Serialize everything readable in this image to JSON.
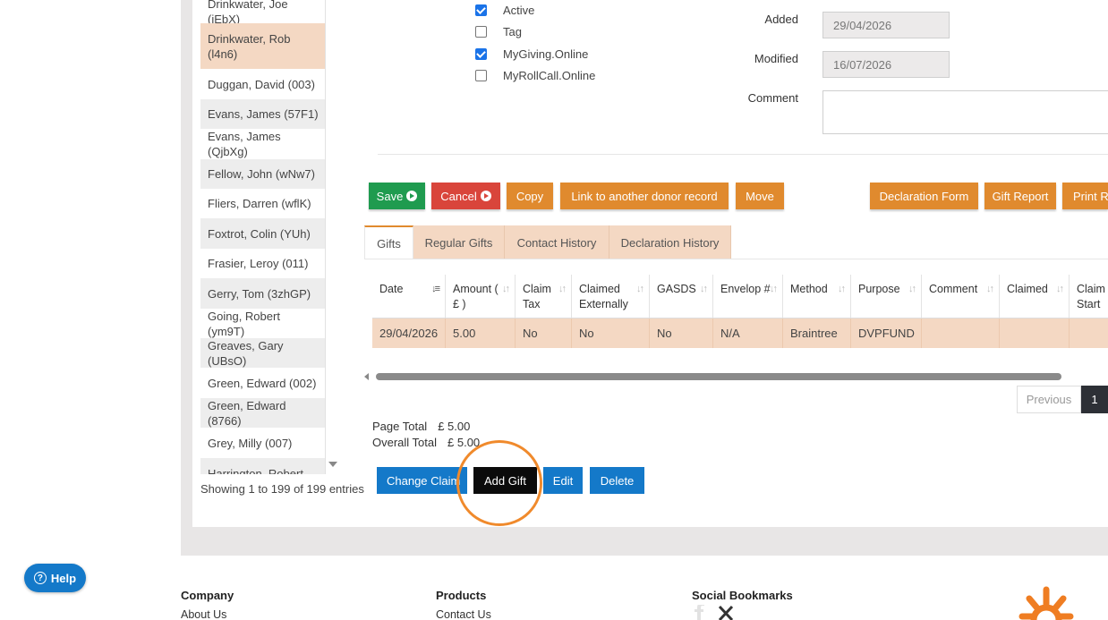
{
  "donor_list": {
    "items": [
      {
        "label": "Drinkwater, Joe (iEbX)"
      },
      {
        "label": "Drinkwater, Rob (l4n6)"
      },
      {
        "label": "Duggan, David (003)"
      },
      {
        "label": "Evans, James (57F1)"
      },
      {
        "label": "Evans, James (QjbXg)"
      },
      {
        "label": "Fellow, John (wNw7)"
      },
      {
        "label": "Fliers, Darren (wflK)"
      },
      {
        "label": "Foxtrot, Colin (YUh)"
      },
      {
        "label": "Frasier, Leroy (011)"
      },
      {
        "label": "Gerry, Tom (3zhGP)"
      },
      {
        "label": "Going, Robert (ym9T)"
      },
      {
        "label": "Greaves, Gary (UBsO)"
      },
      {
        "label": "Green, Edward (002)"
      },
      {
        "label": "Green, Edward (8766)"
      },
      {
        "label": "Grey, Milly (007)"
      },
      {
        "label": "Harrington, Robert"
      }
    ],
    "showing": "Showing 1 to 199 of 199 entries"
  },
  "flags": [
    {
      "label": "Active",
      "checked": true
    },
    {
      "label": "Tag",
      "checked": false
    },
    {
      "label": "MyGiving.Online",
      "checked": true
    },
    {
      "label": "MyRollCall.Online",
      "checked": false
    }
  ],
  "fields": {
    "added_label": "Added",
    "added_value": "29/04/2026",
    "modified_label": "Modified",
    "modified_value": "16/07/2026",
    "comment_label": "Comment"
  },
  "actions": {
    "save": "Save",
    "cancel": "Cancel",
    "copy": "Copy",
    "link": "Link to another donor record",
    "move": "Move",
    "declaration_form": "Declaration Form",
    "gift_report": "Gift Report",
    "print": "Print R"
  },
  "tabs": [
    "Gifts",
    "Regular Gifts",
    "Contact History",
    "Declaration History"
  ],
  "gifts_table": {
    "headers": [
      "Date",
      "Amount ( £ )",
      "Claim Tax",
      "Claimed Externally",
      "GASDS",
      "Envelop #",
      "Method",
      "Purpose",
      "Comment",
      "Claimed",
      "Claim Start"
    ],
    "rows": [
      [
        "29/04/2026",
        "5.00",
        "No",
        "No",
        "No",
        "N/A",
        "Braintree",
        "DVPFUND",
        "",
        "",
        ""
      ]
    ]
  },
  "pagination": {
    "previous": "Previous",
    "current": "1"
  },
  "totals": {
    "page_label": "Page Total",
    "page_value": "£ 5.00",
    "overall_label": "Overall Total",
    "overall_value": "£ 5.00"
  },
  "gift_actions": {
    "change_claim": "Change Claim",
    "add_gift": "Add Gift",
    "edit": "Edit",
    "delete": "Delete"
  },
  "help": {
    "label": "Help"
  },
  "footer": {
    "company_heading": "Company",
    "company_link": "About Us",
    "products_heading": "Products",
    "products_link": "Contact Us",
    "social_heading": "Social Bookmarks"
  },
  "colors": {
    "orange": "#e08a2e",
    "selected_row": "#f4d8c3",
    "blue": "#1479c9",
    "green": "#1f9b4f",
    "red": "#d9453b"
  }
}
